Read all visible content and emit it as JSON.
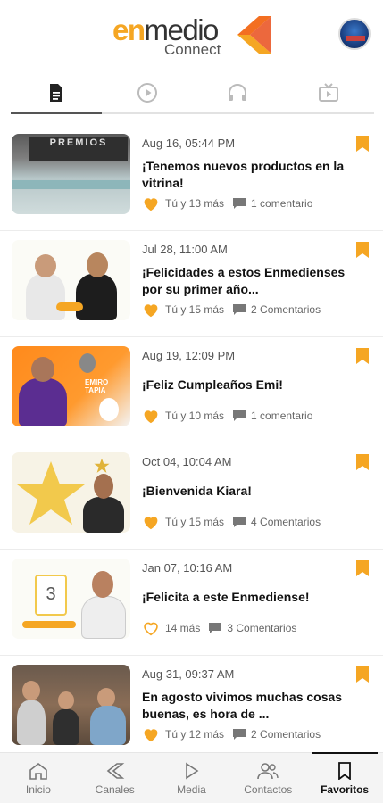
{
  "header": {
    "brand_em": "en",
    "brand_medio": "medio",
    "brand_sub": "Connect"
  },
  "tabs": [
    {
      "icon": "document-icon",
      "active": true
    },
    {
      "icon": "play-icon",
      "active": false
    },
    {
      "icon": "headphones-icon",
      "active": false
    },
    {
      "icon": "tv-icon",
      "active": false
    }
  ],
  "posts": [
    {
      "date": "Aug 16, 05:44 PM",
      "title": "¡Tenemos nuevos productos en la vitrina!",
      "likes": "Tú y 13 más",
      "comments": "1 comentario",
      "liked": true,
      "thumb_text": "PREMIOS"
    },
    {
      "date": "Jul 28, 11:00 AM",
      "title": "¡Felicidades a estos Enmedienses por su primer año...",
      "likes": "Tú y 15 más",
      "comments": "2 Comentarios",
      "liked": true
    },
    {
      "date": "Aug 19, 12:09 PM",
      "title": "¡Feliz Cumpleaños Emi!",
      "likes": "Tú y 10 más",
      "comments": "1 comentario",
      "liked": true,
      "thumb_text": "EMIRO TAPIA"
    },
    {
      "date": "Oct 04, 10:04 AM",
      "title": "¡Bienvenida Kiara!",
      "likes": "Tú y 15 más",
      "comments": "4 Comentarios",
      "liked": true
    },
    {
      "date": "Jan 07, 10:16 AM",
      "title": "¡Felicita a este Enmediense!",
      "likes": "14 más",
      "comments": "3 Comentarios",
      "liked": false,
      "thumb_text": "3"
    },
    {
      "date": "Aug 31, 09:37 AM",
      "title": "En agosto vivimos muchas cosas buenas, es hora de ...",
      "likes": "Tú y 12 más",
      "comments": "2 Comentarios",
      "liked": true
    }
  ],
  "nav": {
    "inicio": "Inicio",
    "canales": "Canales",
    "media": "Media",
    "contactos": "Contactos",
    "favoritos": "Favoritos",
    "active": "favoritos"
  },
  "colors": {
    "accent": "#f5a623",
    "bookmark": "#f5a623",
    "brand_orange": "#f36f21"
  }
}
